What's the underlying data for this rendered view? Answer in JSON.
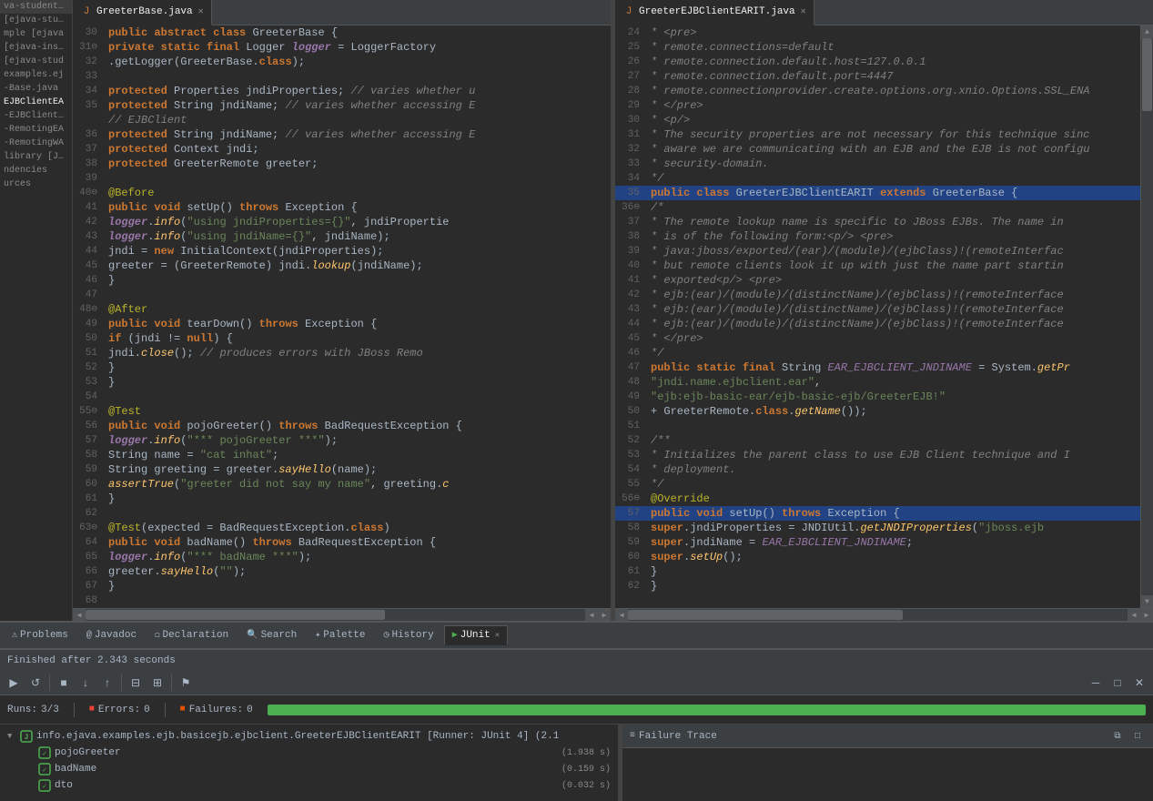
{
  "leftSidebar": {
    "items": [
      {
        "label": "va-student n",
        "active": false
      },
      {
        "label": "[ejava-stude",
        "active": false
      },
      {
        "label": "mple [ejava",
        "active": false
      },
      {
        "label": "[ejava-instr",
        "active": false
      },
      {
        "label": "[ejava-stud",
        "active": false
      },
      {
        "label": "examples.ej",
        "active": false
      },
      {
        "label": "Base.java",
        "active": false
      },
      {
        "label": "EJBClientEA",
        "active": true
      },
      {
        "label": "EJBClientWA",
        "active": false
      },
      {
        "label": "RemotingEA",
        "active": false
      },
      {
        "label": "RemotingWA",
        "active": false
      },
      {
        "label": "library [JavaS",
        "active": false
      },
      {
        "label": "ndencies",
        "active": false
      },
      {
        "label": "urces",
        "active": false
      }
    ]
  },
  "leftEditor": {
    "tabLabel": "GreeterBase.java",
    "lines": [
      {
        "num": 30,
        "content": "<kw>public</kw> <kw>abstract</kw> <kw>class</kw> GreeterBase {"
      },
      {
        "num": 31,
        "content": "    <kw>private</kw> <kw>static</kw> <kw>final</kw> Logger <logger>logger</logger> = LoggerFactory"
      },
      {
        "num": "  ",
        "content": "            .getLogger(GreeterBase.<kw>class</kw>);"
      },
      {
        "num": 33,
        "content": ""
      },
      {
        "num": 34,
        "content": "    <kw>protected</kw> Properties jndiProperties; <cmt>// varies whether u</cmt>"
      },
      {
        "num": 35,
        "content": "    <kw>protected</kw> String jndiName; <cmt>// varies whether accessing E</cmt>"
      },
      {
        "num": "  ",
        "content": "                                             <cmt>// EJBClient</cmt>"
      },
      {
        "num": 36,
        "content": "    <kw>protected</kw> String jndiName; <cmt>// varies whether accessing E</cmt>"
      },
      {
        "num": 37,
        "content": "    <kw>protected</kw> Context jndi;"
      },
      {
        "num": 38,
        "content": "    <kw>protected</kw> GreeterRemote greeter;"
      },
      {
        "num": 39,
        "content": ""
      },
      {
        "num": 40,
        "content": "    <ann>@Before</ann>"
      },
      {
        "num": 41,
        "content": "    <kw>public</kw> <kw>void</kw> setUp() <kw>throws</kw> Exception {"
      },
      {
        "num": 42,
        "content": "        <logger>logger</logger>.<mtd>info</mtd>(<str>\"using jndiProperties={}\"</str>, jndiPropertie"
      },
      {
        "num": 43,
        "content": "        <logger>logger</logger>.<mtd>info</mtd>(<str>\"using jndiName={}\"</str>, jndiName);"
      },
      {
        "num": 44,
        "content": "        jndi = <kw>new</kw> InitialContext(jndiProperties);"
      },
      {
        "num": 45,
        "content": "        greeter = (GreeterRemote) jndi.<mtd>lookup</mtd>(jndiName);"
      },
      {
        "num": 46,
        "content": "    }"
      },
      {
        "num": 47,
        "content": ""
      },
      {
        "num": 48,
        "content": "    <ann>@After</ann>"
      },
      {
        "num": 49,
        "content": "    <kw>public</kw> <kw>void</kw> tearDown() <kw>throws</kw> Exception {"
      },
      {
        "num": 50,
        "content": "        <kw>if</kw> (jndi != <kw>null</kw>) {"
      },
      {
        "num": 51,
        "content": "            jndi.<mtd>close</mtd>(); <cmt>// produces errors with JBoss Remo</cmt>"
      },
      {
        "num": 52,
        "content": "        }"
      },
      {
        "num": 53,
        "content": "    }"
      },
      {
        "num": 54,
        "content": ""
      },
      {
        "num": 55,
        "content": "    <ann>@Test</ann>"
      },
      {
        "num": 56,
        "content": "    <kw>public</kw> <kw>void</kw> pojoGreeter() <kw>throws</kw> BadRequestException {"
      },
      {
        "num": 57,
        "content": "        <logger>logger</logger>.<mtd>info</mtd>(<str>\"*** pojoGreeter ***\"</str>);"
      },
      {
        "num": 58,
        "content": "        String name = <str>\"cat inhat\"</str>;"
      },
      {
        "num": 59,
        "content": "        String greeting = greeter.<mtd>sayHello</mtd>(name);"
      },
      {
        "num": 60,
        "content": "        <mtd>assertTrue</mtd>(<str>\"greeter did not say my name\"</str>, greeting.<mtd>c</mtd>"
      },
      {
        "num": 61,
        "content": "    }"
      },
      {
        "num": 62,
        "content": ""
      },
      {
        "num": 63,
        "content": "    <ann>@Test</ann>(expected = BadRequestException.<kw>class</kw>)"
      },
      {
        "num": 64,
        "content": "    <kw>public</kw> <kw>void</kw> badName() <kw>throws</kw> BadRequestException {"
      },
      {
        "num": 65,
        "content": "        <logger>logger</logger>.<mtd>info</mtd>(<str>\"*** badName ***\"</str>);"
      },
      {
        "num": 66,
        "content": "        greeter.<mtd>sayHello</mtd>(<str>\"\"</str>);"
      },
      {
        "num": 67,
        "content": "    }"
      },
      {
        "num": 68,
        "content": ""
      }
    ]
  },
  "rightEditor": {
    "tabLabel": "GreeterEJBClientEARIT.java",
    "lines": [
      {
        "num": 24,
        "content": "<cmt> * &lt;pre&gt;</cmt>"
      },
      {
        "num": 25,
        "content": "<cmt> * remote.connections=default</cmt>"
      },
      {
        "num": 26,
        "content": "<cmt> * remote.connection.default.host=127.0.0.1</cmt>"
      },
      {
        "num": 27,
        "content": "<cmt> * remote.connection.default.port=4447</cmt>"
      },
      {
        "num": 28,
        "content": "<cmt> * remote.connectionprovider.create.options.org.xnio.Options.SSL_ENA</cmt>"
      },
      {
        "num": 29,
        "content": "<cmt> * &lt;/pre&gt;</cmt>"
      },
      {
        "num": 30,
        "content": "<cmt> * &lt;p/&gt;</cmt>"
      },
      {
        "num": 31,
        "content": "<cmt> * The security properties are not necessary for this technique sinc</cmt>"
      },
      {
        "num": 32,
        "content": "<cmt> * aware we are communicating with an EJB and the EJB is not configu</cmt>"
      },
      {
        "num": 33,
        "content": "<cmt> * security-domain.</cmt>"
      },
      {
        "num": 34,
        "content": "<cmt> */</cmt>"
      },
      {
        "num": 35,
        "content": "<kw>public</kw> <kw>class</kw> GreeterEJBClientEARIT <kw>extends</kw> GreeterBase {",
        "highlight": true
      },
      {
        "num": 36,
        "content": "    <cmt>/*</cmt>"
      },
      {
        "num": 37,
        "content": "<cmt>     * The remote lookup name is specific to JBoss EJBs. The name in</cmt>"
      },
      {
        "num": 38,
        "content": "<cmt>     * is of the following form:&lt;p/&gt; &lt;pre&gt;</cmt>"
      },
      {
        "num": 39,
        "content": "<cmt>     * java:jboss/exported/(ear)/(module)/(ejbClass)!(remoteInterfac</cmt>"
      },
      {
        "num": 40,
        "content": "<cmt>     * but remote clients look it up with just the name part startin</cmt>"
      },
      {
        "num": 41,
        "content": "<cmt>     * exported&lt;p/&gt; &lt;pre&gt;</cmt>"
      },
      {
        "num": 42,
        "content": "<cmt>     * ejb:(ear)/(module)/(distinctName)/(ejbClass)!(remoteInterface</cmt>"
      },
      {
        "num": 43,
        "content": "<cmt>     * ejb:(ear)/(module)/(distinctName)/(ejbClass)!(remoteInterface</cmt>"
      },
      {
        "num": 44,
        "content": "<cmt>     * ejb:(ear)/(module)/(distinctName)/(ejbClass)!(remoteInterface</cmt>"
      },
      {
        "num": 45,
        "content": "<cmt>     * &lt;/pre&gt;</cmt>"
      },
      {
        "num": 46,
        "content": "<cmt>     */</cmt>"
      },
      {
        "num": 47,
        "content": "    <kw>public</kw> <kw>static</kw> <kw>final</kw> String <var>EAR_EJBCLIENT_JNDINAME</var> = System.<mtd>getPr</mtd>"
      },
      {
        "num": 48,
        "content": "            <str>\"jndi.name.ejbclient.ear\"</str>,"
      },
      {
        "num": 49,
        "content": "            <str>\"ejb:ejb-basic-ear/ejb-basic-ejb/GreeterEJB!\"</str>"
      },
      {
        "num": 50,
        "content": "                    + GreeterRemote.<kw>class</kw>.<mtd>getName</mtd>());"
      },
      {
        "num": 51,
        "content": ""
      },
      {
        "num": 52,
        "content": "    <cmt>/**</cmt>"
      },
      {
        "num": 53,
        "content": "<cmt>     * Initializes the parent class to use EJB Client technique and I</cmt>"
      },
      {
        "num": 54,
        "content": "<cmt>     * deployment.</cmt>"
      },
      {
        "num": 55,
        "content": "<cmt>     */</cmt>"
      },
      {
        "num": 56,
        "content": "    <ann>@Override</ann>"
      },
      {
        "num": 57,
        "content": "    <kw>public</kw> <kw>void</kw> setUp() <kw>throws</kw> Exception {",
        "highlight": true
      },
      {
        "num": 58,
        "content": "        <kw>super</kw>.jndiProperties = JNDIUtil.<mtd>getJNDIProperties</mtd>(<str>\"jboss.ejb</str>"
      },
      {
        "num": 59,
        "content": "        <kw>super</kw>.jndiName = <var>EAR_EJBCLIENT_JNDINAME</var>;"
      },
      {
        "num": 60,
        "content": "        <kw>super</kw>.<mtd>setUp</mtd>();"
      },
      {
        "num": 61,
        "content": "    }"
      },
      {
        "num": 62,
        "content": "}"
      }
    ]
  },
  "bottomTabs": {
    "tabs": [
      {
        "icon": "⚠",
        "label": "Problems",
        "active": false,
        "closable": false
      },
      {
        "icon": "J",
        "label": "Javadoc",
        "active": false,
        "closable": false
      },
      {
        "icon": "D",
        "label": "Declaration",
        "active": false,
        "closable": false
      },
      {
        "icon": "S",
        "label": "Search",
        "active": false,
        "closable": false
      },
      {
        "icon": "P",
        "label": "Palette",
        "active": false,
        "closable": false
      },
      {
        "icon": "H",
        "label": "History",
        "active": false,
        "closable": false
      },
      {
        "icon": "▶",
        "label": "JUnit",
        "active": true,
        "closable": true
      }
    ]
  },
  "statusBar": {
    "message": "Finished after 2.343 seconds"
  },
  "junit": {
    "runs": {
      "label": "Runs:",
      "value": "3/3"
    },
    "errors": {
      "label": "Errors:",
      "value": "0"
    },
    "failures": {
      "label": "Failures:",
      "value": "0"
    },
    "progressColor": "#4caf50",
    "treeItems": [
      {
        "label": "info.ejava.examples.ejb.basicejb.ejbclient.GreeterEJBClientEARIT [Runner: JUnit 4] (2.1",
        "type": "suite",
        "expanded": true,
        "children": [
          {
            "label": "pojoGreeter",
            "time": "(1.938 s)",
            "type": "pass"
          },
          {
            "label": "badName",
            "time": "(0.159 s)",
            "type": "pass"
          },
          {
            "label": "dto",
            "time": "(0.032 s)",
            "type": "pass"
          }
        ]
      }
    ],
    "failureTrace": {
      "title": "Failure Trace",
      "content": ""
    }
  }
}
